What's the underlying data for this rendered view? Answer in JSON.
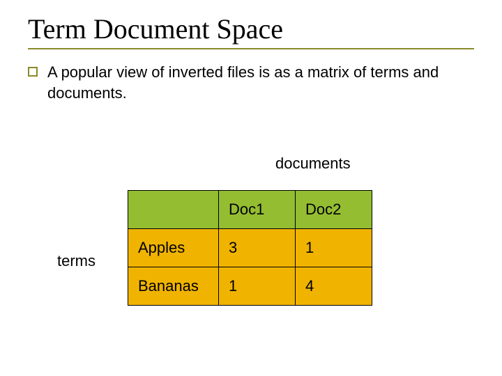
{
  "title": "Term Document Space",
  "bullet": "A popular view of inverted files is as a matrix of terms and documents.",
  "labels": {
    "documents": "documents",
    "terms": "terms"
  },
  "chart_data": {
    "type": "table",
    "columns": [
      "Doc1",
      "Doc2"
    ],
    "rows": [
      "Apples",
      "Bananas"
    ],
    "values": [
      [
        3,
        1
      ],
      [
        1,
        4
      ]
    ]
  }
}
